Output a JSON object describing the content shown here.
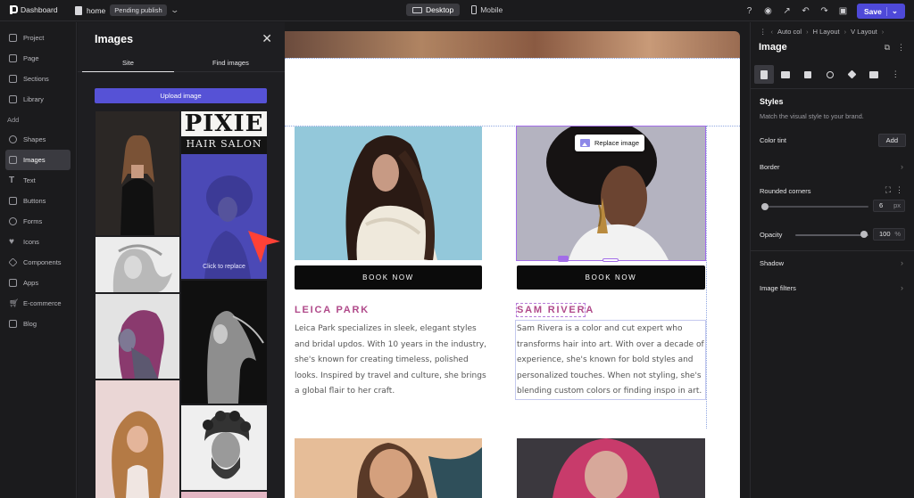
{
  "topbar": {
    "app_name": "Dashboard",
    "page_name": "home",
    "status_badge": "Pending publish",
    "devices": [
      "Desktop",
      "Mobile"
    ],
    "save_label": "Save"
  },
  "leftnav": {
    "items_top": [
      {
        "label": "Project",
        "icon": "folder-icon"
      },
      {
        "label": "Page",
        "icon": "page-icon"
      },
      {
        "label": "Sections",
        "icon": "sections-icon"
      },
      {
        "label": "Library",
        "icon": "library-icon"
      }
    ],
    "add_heading": "Add",
    "items_add": [
      {
        "label": "Shapes",
        "icon": "shapes-icon"
      },
      {
        "label": "Images",
        "icon": "image-icon",
        "active": true
      },
      {
        "label": "Text",
        "icon": "text-icon"
      },
      {
        "label": "Buttons",
        "icon": "button-icon"
      },
      {
        "label": "Forms",
        "icon": "form-icon"
      },
      {
        "label": "Icons",
        "icon": "heart-icon"
      },
      {
        "label": "Components",
        "icon": "component-icon"
      },
      {
        "label": "Apps",
        "icon": "apps-icon"
      },
      {
        "label": "E-commerce",
        "icon": "cart-icon"
      },
      {
        "label": "Blog",
        "icon": "blog-icon"
      }
    ]
  },
  "images_panel": {
    "title": "Images",
    "tabs": [
      "Site",
      "Find images"
    ],
    "upload_label": "Upload image",
    "salon_logo_top": "PIXIE",
    "salon_logo_bottom": "HAIR SALON",
    "hover_label": "Click to replace"
  },
  "canvas": {
    "cards": [
      {
        "button": "BOOK NOW",
        "name": "LEICA PARK",
        "bio": [
          "Leica Park specializes in sleek, elegant styles",
          "and bridal updos. With 10 years in the industry,",
          "she's known for creating timeless, polished",
          "looks. Inspired by travel and culture, she brings",
          "a global flair to her craft."
        ]
      },
      {
        "button": "BOOK NOW",
        "name": "SAM RIVERA",
        "bio": [
          "Sam Rivera is a color and cut expert who",
          "transforms hair into art. With over a decade of",
          "experience, she's known for bold styles and",
          "personalized touches. When not styling, she's",
          "blending custom colors or finding inspo in art."
        ]
      }
    ],
    "replace_label": "Replace image"
  },
  "rightpanel": {
    "breadcrumb": [
      "Auto col",
      "H Layout",
      "V Layout"
    ],
    "title": "Image",
    "styles_heading": "Styles",
    "styles_sub": "Match the visual style to your brand.",
    "color_tint": "Color tint",
    "add_label": "Add",
    "border": "Border",
    "rounded_corners": "Rounded corners",
    "rounded_value": "6",
    "rounded_unit": "px",
    "opacity": "Opacity",
    "opacity_value": "100",
    "opacity_unit": "%",
    "shadow": "Shadow",
    "image_filters": "Image filters"
  },
  "colors": {
    "accent": "#4e49d8",
    "selection": "#a26de8",
    "name_pink": "#b04a8a"
  }
}
